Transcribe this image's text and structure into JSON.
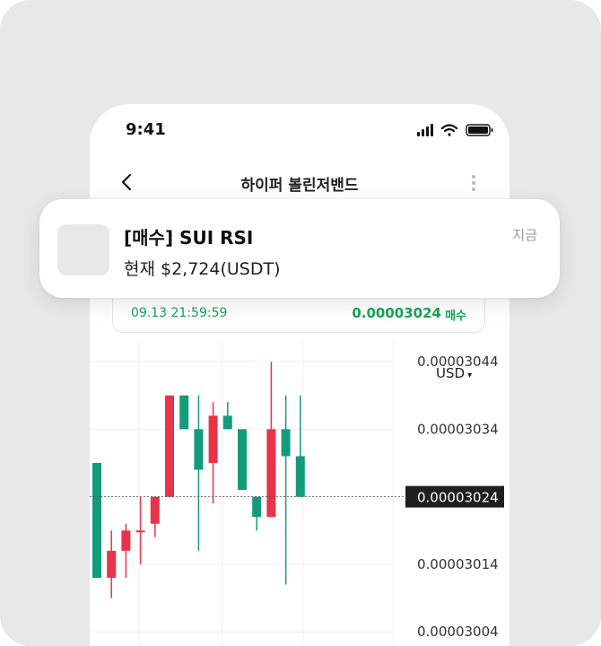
{
  "status_bar": {
    "time": "9:41"
  },
  "nav": {
    "title": "하이퍼 볼린저밴드"
  },
  "notification": {
    "title": "[매수] SUI RSI",
    "body": "현재 $2,724(USDT)",
    "time": "지금"
  },
  "signal": {
    "time": "09.13 21:59:59",
    "price": "0.00003024",
    "side": "매수"
  },
  "colors": {
    "up": "#e8334a",
    "down": "#149b7c",
    "accent_green": "#1aa156"
  },
  "chart_data": {
    "type": "candlestick",
    "currency": "USD",
    "y_ticks": [
      "0.00003044",
      "0.00003034",
      "0.00003024",
      "0.00003014",
      "0.00003004"
    ],
    "current_price": "0.00003024",
    "ylim": [
      3.0019e-05,
      3.0468e-05
    ],
    "candles": [
      {
        "o": 3.029e-05,
        "c": 3.012e-05,
        "h": 3.029e-05,
        "l": 3.012e-05
      },
      {
        "o": 3.012e-05,
        "c": 3.016e-05,
        "h": 3.019e-05,
        "l": 3.009e-05
      },
      {
        "o": 3.016e-05,
        "c": 3.019e-05,
        "h": 3.02e-05,
        "l": 3.012e-05
      },
      {
        "o": 3.019e-05,
        "c": 3.019e-05,
        "h": 3.024e-05,
        "l": 3.014e-05
      },
      {
        "o": 3.02e-05,
        "c": 3.024e-05,
        "h": 3.024e-05,
        "l": 3.018e-05
      },
      {
        "o": 3.024e-05,
        "c": 3.039e-05,
        "h": 3.039e-05,
        "l": 3.024e-05
      },
      {
        "o": 3.039e-05,
        "c": 3.034e-05,
        "h": 3.039e-05,
        "l": 3.034e-05
      },
      {
        "o": 3.034e-05,
        "c": 3.028e-05,
        "h": 3.039e-05,
        "l": 3.016e-05
      },
      {
        "o": 3.029e-05,
        "c": 3.036e-05,
        "h": 3.038e-05,
        "l": 3.023e-05
      },
      {
        "o": 3.036e-05,
        "c": 3.034e-05,
        "h": 3.038e-05,
        "l": 3.034e-05
      },
      {
        "o": 3.034e-05,
        "c": 3.025e-05,
        "h": 3.034e-05,
        "l": 3.025e-05
      },
      {
        "o": 3.024e-05,
        "c": 3.021e-05,
        "h": 3.024e-05,
        "l": 3.019e-05
      },
      {
        "o": 3.021e-05,
        "c": 3.034e-05,
        "h": 3.044e-05,
        "l": 3.021e-05
      },
      {
        "o": 3.034e-05,
        "c": 3.03e-05,
        "h": 3.039e-05,
        "l": 3.011e-05
      },
      {
        "o": 3.03e-05,
        "c": 3.024e-05,
        "h": 3.039e-05,
        "l": 3.024e-05
      }
    ]
  }
}
